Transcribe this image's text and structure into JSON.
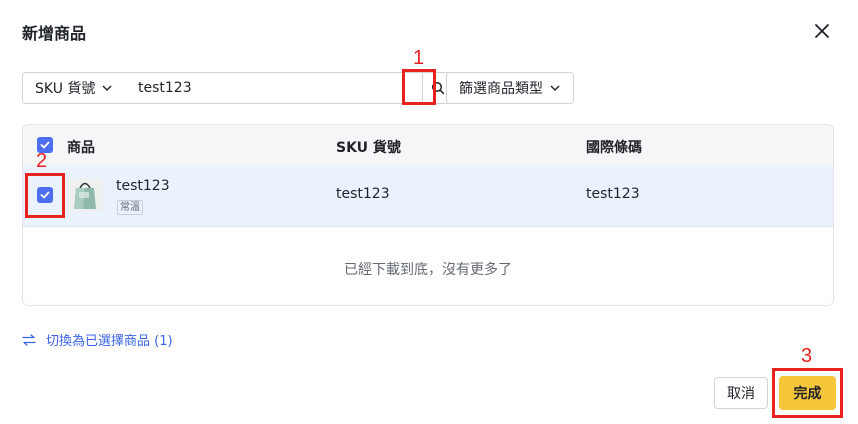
{
  "dialog": {
    "title": "新增商品",
    "close_icon": "close-icon"
  },
  "search": {
    "field_select_label": "SKU 貨號",
    "value": "test123",
    "placeholder": ""
  },
  "filter": {
    "label": "篩選商品類型"
  },
  "table": {
    "columns": [
      "商品",
      "SKU 貨號",
      "國際條碼"
    ],
    "rows": [
      {
        "name": "test123",
        "tag": "常溫",
        "sku": "test123",
        "barcode": "test123",
        "checked": true
      }
    ],
    "end_text": "已經下載到底，沒有更多了"
  },
  "footer": {
    "switch_label": "切換為已選擇商品 (1)",
    "cancel_label": "取消",
    "done_label": "完成"
  },
  "annotations": [
    "1",
    "2",
    "3"
  ],
  "colors": {
    "accent": "#4e6ef2",
    "primary_button": "#f5c53a",
    "annotation": "#e8231f",
    "link": "#3b63e8",
    "row_selected": "#eaf2fd"
  }
}
